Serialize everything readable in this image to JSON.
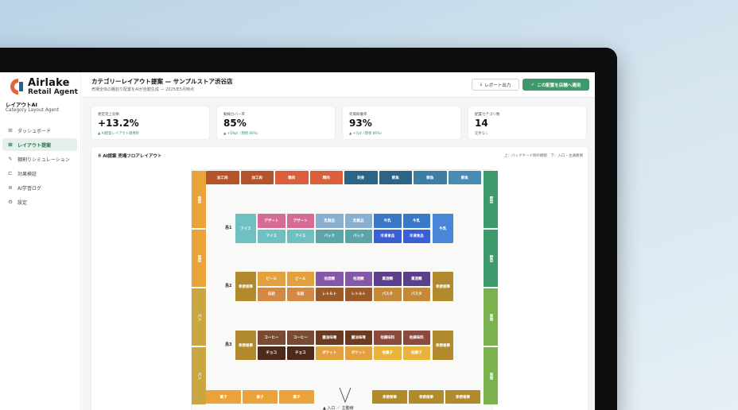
{
  "brand": {
    "name": "Airlake",
    "sub": "Retail Agent"
  },
  "app": {
    "name": "レイアウトAI",
    "sub": "Category Layout Agent"
  },
  "nav": [
    {
      "icon": "⊞",
      "label": "ダッシュボード"
    },
    {
      "icon": "⊠",
      "label": "レイアウト提案",
      "active": true
    },
    {
      "icon": "✎",
      "label": "棚割りシミュレーション"
    },
    {
      "icon": "⊏",
      "label": "効果検証"
    },
    {
      "icon": "⊕",
      "label": "AI学習ログ"
    },
    {
      "icon": "⚙",
      "label": "設定"
    }
  ],
  "header": {
    "title": "カテゴリーレイアウト提案 — サンプルストア渋谷店",
    "subtitle": "売場全体の棚割り配置をAIが自動生成 — 2025年5月時点",
    "report_btn": "レポート出力",
    "apply_btn": "この配置を店舗へ適用",
    "report_icon": "download-icon",
    "apply_icon": "check-icon"
  },
  "kpis": [
    {
      "label": "想定売上効果",
      "value": "+13.2%",
      "note": "▲ AI提案レイアウト適用時",
      "accent": "#2e9460"
    },
    {
      "label": "動線カバー率",
      "value": "85%",
      "note": "▲ +19pt（現状 66%）",
      "accent": "#2e9460"
    },
    {
      "label": "売場稼働率",
      "value": "93%",
      "note": "▲ +7pt（現状 86%）",
      "accent": "#2e9460"
    },
    {
      "label": "配置カテゴリ数",
      "value": "14",
      "note": "変更なし",
      "accent": "#777777"
    }
  ],
  "layout": {
    "title": "AI提案 売場フロアレイアウト",
    "legend": "上：バックヤード側の棚割　下：入口・主通路側",
    "entrance": "▲ 入口 ／ 主動線",
    "top_row": [
      {
        "label": "加工肉",
        "color": "#b5532b"
      },
      {
        "label": "加工肉",
        "color": "#b5532b"
      },
      {
        "label": "精肉",
        "color": "#d9603b"
      },
      {
        "label": "精肉",
        "color": "#d9603b"
      },
      {
        "label": "刺身",
        "color": "#2c6486"
      },
      {
        "label": "鮮魚",
        "color": "#2c6486"
      },
      {
        "label": "鮮魚",
        "color": "#3e7ea3"
      },
      {
        "label": "鮮魚",
        "color": "#4a8bb3"
      }
    ],
    "left_col": [
      {
        "label": "惣菜",
        "color": "#e8a33a"
      },
      {
        "label": "惣菜",
        "color": "#e8a33a"
      },
      {
        "label": "パン",
        "color": "#c9a640"
      },
      {
        "label": "パン",
        "color": "#c9a640"
      }
    ],
    "right_col": [
      {
        "label": "野菜",
        "color": "#3f9a6b"
      },
      {
        "label": "野菜",
        "color": "#3f9a6b"
      },
      {
        "label": "果物",
        "color": "#7ab24d"
      },
      {
        "label": "果物",
        "color": "#7ab24d"
      }
    ],
    "bottom_left": [
      {
        "label": "菓子",
        "color": "#e8a33a"
      },
      {
        "label": "菓子",
        "color": "#e8a33a"
      },
      {
        "label": "菓子",
        "color": "#e8a33a"
      }
    ],
    "bottom_right": [
      {
        "label": "季節催事",
        "color": "#b08a2c"
      },
      {
        "label": "季節催事",
        "color": "#b08a2c"
      },
      {
        "label": "季節催事",
        "color": "#b08a2c"
      }
    ],
    "islands": [
      {
        "label": "島1",
        "left": {
          "label": "アイス",
          "color": "#6fc0c0"
        },
        "top": [
          {
            "label": "デザート",
            "color": "#d66b96"
          },
          {
            "label": "デザート",
            "color": "#d66b96"
          },
          {
            "label": "乳製品",
            "color": "#8ab0d1"
          },
          {
            "label": "乳製品",
            "color": "#8ab0d1"
          },
          {
            "label": "牛乳",
            "color": "#3c78c8"
          },
          {
            "label": "牛乳",
            "color": "#3c78c8"
          }
        ],
        "bottom": [
          {
            "label": "アイス",
            "color": "#6fc0c0"
          },
          {
            "label": "アイス",
            "color": "#6fc0c0"
          },
          {
            "label": "パック",
            "color": "#5aa5a8"
          },
          {
            "label": "パック",
            "color": "#5aa5a8"
          },
          {
            "label": "冷凍食品",
            "color": "#3a5ed3"
          },
          {
            "label": "冷凍食品",
            "color": "#3a5ed3"
          }
        ],
        "right": {
          "label": "牛乳",
          "color": "#4a86d8"
        }
      },
      {
        "label": "島2",
        "left": {
          "label": "季節催事",
          "color": "#b08a2c"
        },
        "top": [
          {
            "label": "ビール",
            "color": "#e3a03e"
          },
          {
            "label": "ビール",
            "color": "#e3a03e"
          },
          {
            "label": "他酒類",
            "color": "#8557a8"
          },
          {
            "label": "他酒類",
            "color": "#8557a8"
          },
          {
            "label": "菓酒類",
            "color": "#5b3f8a"
          },
          {
            "label": "菓酒類",
            "color": "#5b3f8a"
          }
        ],
        "bottom": [
          {
            "label": "缶詰",
            "color": "#d08a46"
          },
          {
            "label": "缶詰",
            "color": "#d08a46"
          },
          {
            "label": "レトルト",
            "color": "#9a5a2a"
          },
          {
            "label": "レトルト",
            "color": "#9a5a2a"
          },
          {
            "label": "パスタ",
            "color": "#c48a3a"
          },
          {
            "label": "パスタ",
            "color": "#c48a3a"
          }
        ],
        "right": {
          "label": "季節催事",
          "color": "#b08a2c"
        }
      },
      {
        "label": "島3",
        "left": {
          "label": "季節催事",
          "color": "#b08a2c"
        },
        "top": [
          {
            "label": "コーヒー",
            "color": "#7a4a35"
          },
          {
            "label": "コーヒー",
            "color": "#7a4a35"
          },
          {
            "label": "醤油味噌",
            "color": "#6b3a1f"
          },
          {
            "label": "醤油味噌",
            "color": "#6b3a1f"
          },
          {
            "label": "他調味料",
            "color": "#8c4a3c"
          },
          {
            "label": "他調味料",
            "color": "#8c4a3c"
          }
        ],
        "bottom": [
          {
            "label": "チョコ",
            "color": "#4e2a1a"
          },
          {
            "label": "チョコ",
            "color": "#4e2a1a"
          },
          {
            "label": "ポケット",
            "color": "#e3a03e"
          },
          {
            "label": "ポケット",
            "color": "#e3a03e"
          },
          {
            "label": "他菓子",
            "color": "#e8b53c"
          },
          {
            "label": "他菓子",
            "color": "#e8b53c"
          }
        ],
        "right": {
          "label": "季節催事",
          "color": "#b08a2c"
        }
      }
    ]
  }
}
